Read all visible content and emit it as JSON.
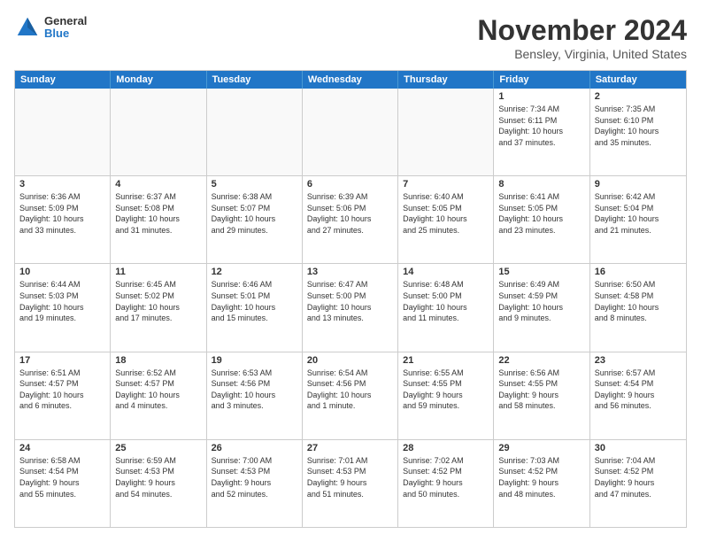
{
  "logo": {
    "general": "General",
    "blue": "Blue"
  },
  "header": {
    "month": "November 2024",
    "location": "Bensley, Virginia, United States"
  },
  "weekdays": [
    "Sunday",
    "Monday",
    "Tuesday",
    "Wednesday",
    "Thursday",
    "Friday",
    "Saturday"
  ],
  "rows": [
    [
      {
        "day": "",
        "empty": true
      },
      {
        "day": "",
        "empty": true
      },
      {
        "day": "",
        "empty": true
      },
      {
        "day": "",
        "empty": true
      },
      {
        "day": "",
        "empty": true
      },
      {
        "day": "1",
        "lines": [
          "Sunrise: 7:34 AM",
          "Sunset: 6:11 PM",
          "Daylight: 10 hours",
          "and 37 minutes."
        ]
      },
      {
        "day": "2",
        "lines": [
          "Sunrise: 7:35 AM",
          "Sunset: 6:10 PM",
          "Daylight: 10 hours",
          "and 35 minutes."
        ]
      }
    ],
    [
      {
        "day": "3",
        "lines": [
          "Sunrise: 6:36 AM",
          "Sunset: 5:09 PM",
          "Daylight: 10 hours",
          "and 33 minutes."
        ]
      },
      {
        "day": "4",
        "lines": [
          "Sunrise: 6:37 AM",
          "Sunset: 5:08 PM",
          "Daylight: 10 hours",
          "and 31 minutes."
        ]
      },
      {
        "day": "5",
        "lines": [
          "Sunrise: 6:38 AM",
          "Sunset: 5:07 PM",
          "Daylight: 10 hours",
          "and 29 minutes."
        ]
      },
      {
        "day": "6",
        "lines": [
          "Sunrise: 6:39 AM",
          "Sunset: 5:06 PM",
          "Daylight: 10 hours",
          "and 27 minutes."
        ]
      },
      {
        "day": "7",
        "lines": [
          "Sunrise: 6:40 AM",
          "Sunset: 5:05 PM",
          "Daylight: 10 hours",
          "and 25 minutes."
        ]
      },
      {
        "day": "8",
        "lines": [
          "Sunrise: 6:41 AM",
          "Sunset: 5:05 PM",
          "Daylight: 10 hours",
          "and 23 minutes."
        ]
      },
      {
        "day": "9",
        "lines": [
          "Sunrise: 6:42 AM",
          "Sunset: 5:04 PM",
          "Daylight: 10 hours",
          "and 21 minutes."
        ]
      }
    ],
    [
      {
        "day": "10",
        "lines": [
          "Sunrise: 6:44 AM",
          "Sunset: 5:03 PM",
          "Daylight: 10 hours",
          "and 19 minutes."
        ]
      },
      {
        "day": "11",
        "lines": [
          "Sunrise: 6:45 AM",
          "Sunset: 5:02 PM",
          "Daylight: 10 hours",
          "and 17 minutes."
        ]
      },
      {
        "day": "12",
        "lines": [
          "Sunrise: 6:46 AM",
          "Sunset: 5:01 PM",
          "Daylight: 10 hours",
          "and 15 minutes."
        ]
      },
      {
        "day": "13",
        "lines": [
          "Sunrise: 6:47 AM",
          "Sunset: 5:00 PM",
          "Daylight: 10 hours",
          "and 13 minutes."
        ]
      },
      {
        "day": "14",
        "lines": [
          "Sunrise: 6:48 AM",
          "Sunset: 5:00 PM",
          "Daylight: 10 hours",
          "and 11 minutes."
        ]
      },
      {
        "day": "15",
        "lines": [
          "Sunrise: 6:49 AM",
          "Sunset: 4:59 PM",
          "Daylight: 10 hours",
          "and 9 minutes."
        ]
      },
      {
        "day": "16",
        "lines": [
          "Sunrise: 6:50 AM",
          "Sunset: 4:58 PM",
          "Daylight: 10 hours",
          "and 8 minutes."
        ]
      }
    ],
    [
      {
        "day": "17",
        "lines": [
          "Sunrise: 6:51 AM",
          "Sunset: 4:57 PM",
          "Daylight: 10 hours",
          "and 6 minutes."
        ]
      },
      {
        "day": "18",
        "lines": [
          "Sunrise: 6:52 AM",
          "Sunset: 4:57 PM",
          "Daylight: 10 hours",
          "and 4 minutes."
        ]
      },
      {
        "day": "19",
        "lines": [
          "Sunrise: 6:53 AM",
          "Sunset: 4:56 PM",
          "Daylight: 10 hours",
          "and 3 minutes."
        ]
      },
      {
        "day": "20",
        "lines": [
          "Sunrise: 6:54 AM",
          "Sunset: 4:56 PM",
          "Daylight: 10 hours",
          "and 1 minute."
        ]
      },
      {
        "day": "21",
        "lines": [
          "Sunrise: 6:55 AM",
          "Sunset: 4:55 PM",
          "Daylight: 9 hours",
          "and 59 minutes."
        ]
      },
      {
        "day": "22",
        "lines": [
          "Sunrise: 6:56 AM",
          "Sunset: 4:55 PM",
          "Daylight: 9 hours",
          "and 58 minutes."
        ]
      },
      {
        "day": "23",
        "lines": [
          "Sunrise: 6:57 AM",
          "Sunset: 4:54 PM",
          "Daylight: 9 hours",
          "and 56 minutes."
        ]
      }
    ],
    [
      {
        "day": "24",
        "lines": [
          "Sunrise: 6:58 AM",
          "Sunset: 4:54 PM",
          "Daylight: 9 hours",
          "and 55 minutes."
        ]
      },
      {
        "day": "25",
        "lines": [
          "Sunrise: 6:59 AM",
          "Sunset: 4:53 PM",
          "Daylight: 9 hours",
          "and 54 minutes."
        ]
      },
      {
        "day": "26",
        "lines": [
          "Sunrise: 7:00 AM",
          "Sunset: 4:53 PM",
          "Daylight: 9 hours",
          "and 52 minutes."
        ]
      },
      {
        "day": "27",
        "lines": [
          "Sunrise: 7:01 AM",
          "Sunset: 4:53 PM",
          "Daylight: 9 hours",
          "and 51 minutes."
        ]
      },
      {
        "day": "28",
        "lines": [
          "Sunrise: 7:02 AM",
          "Sunset: 4:52 PM",
          "Daylight: 9 hours",
          "and 50 minutes."
        ]
      },
      {
        "day": "29",
        "lines": [
          "Sunrise: 7:03 AM",
          "Sunset: 4:52 PM",
          "Daylight: 9 hours",
          "and 48 minutes."
        ]
      },
      {
        "day": "30",
        "lines": [
          "Sunrise: 7:04 AM",
          "Sunset: 4:52 PM",
          "Daylight: 9 hours",
          "and 47 minutes."
        ]
      }
    ]
  ]
}
